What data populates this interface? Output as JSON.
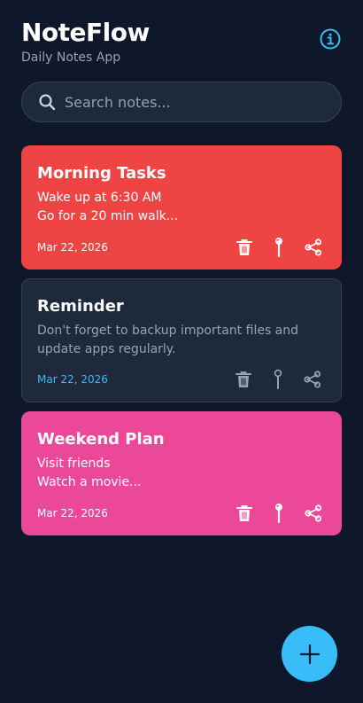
{
  "app": {
    "title": "NoteFlow",
    "subtitle": "Daily Notes App",
    "info_icon": "info-icon"
  },
  "search": {
    "placeholder": "Search notes...",
    "value": "",
    "icon": "search-icon"
  },
  "notes": [
    {
      "title": "Morning Tasks",
      "body": "Wake up at 6:30 AM\nGo for a 20 min walk...",
      "date": "Mar 22, 2026",
      "color": "#ef4444"
    },
    {
      "title": "Reminder",
      "body": "Don't forget to backup important files and update apps regularly.",
      "date": "Mar 22, 2026",
      "color": "#1e293b"
    },
    {
      "title": "Weekend Plan",
      "body": "Visit friends\nWatch a movie...",
      "date": "Mar 22, 2026",
      "color": "#ec4899"
    }
  ],
  "note_actions": [
    "trash-icon",
    "pin-icon",
    "share-icon"
  ],
  "fab": {
    "icon": "plus-icon",
    "color": "#38bdf8"
  },
  "colors": {
    "background": "#0f172a",
    "accent": "#38bdf8",
    "surface": "#1e293b"
  }
}
